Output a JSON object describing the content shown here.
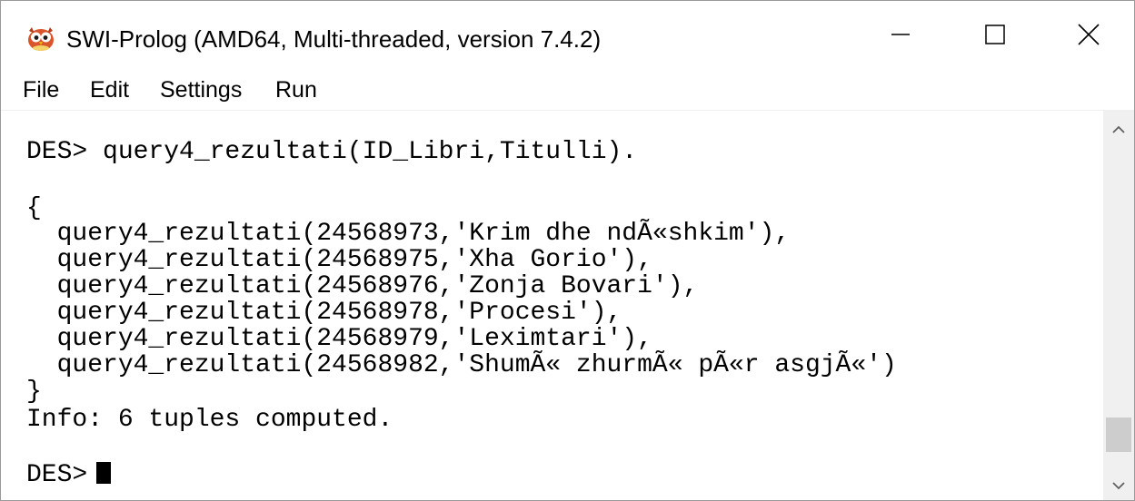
{
  "window": {
    "title": "SWI-Prolog (AMD64, Multi-threaded, version 7.4.2)",
    "app_icon": "owl-icon",
    "controls": [
      "minimize-icon",
      "maximize-icon",
      "close-icon"
    ]
  },
  "menu": {
    "items": [
      "File",
      "Edit",
      "Settings",
      "Run"
    ]
  },
  "console": {
    "lines": [
      "DES> query4_rezultati(ID_Libri,Titulli).",
      "",
      "{",
      "  query4_rezultati(24568973,'Krim dhe ndÃ«shkim'),",
      "  query4_rezultati(24568975,'Xha Gorio'),",
      "  query4_rezultati(24568976,'Zonja Bovari'),",
      "  query4_rezultati(24568978,'Procesi'),",
      "  query4_rezultati(24568979,'Leximtari'),",
      "  query4_rezultati(24568982,'ShumÃ« zhurmÃ« pÃ«r asgjÃ«')",
      "}",
      "Info: 6 tuples computed.",
      "",
      "DES>"
    ]
  },
  "scrollbar": {
    "up_icon": "scroll-up-arrow-icon",
    "down_icon": "scroll-down-arrow-icon",
    "position": 0.88
  }
}
